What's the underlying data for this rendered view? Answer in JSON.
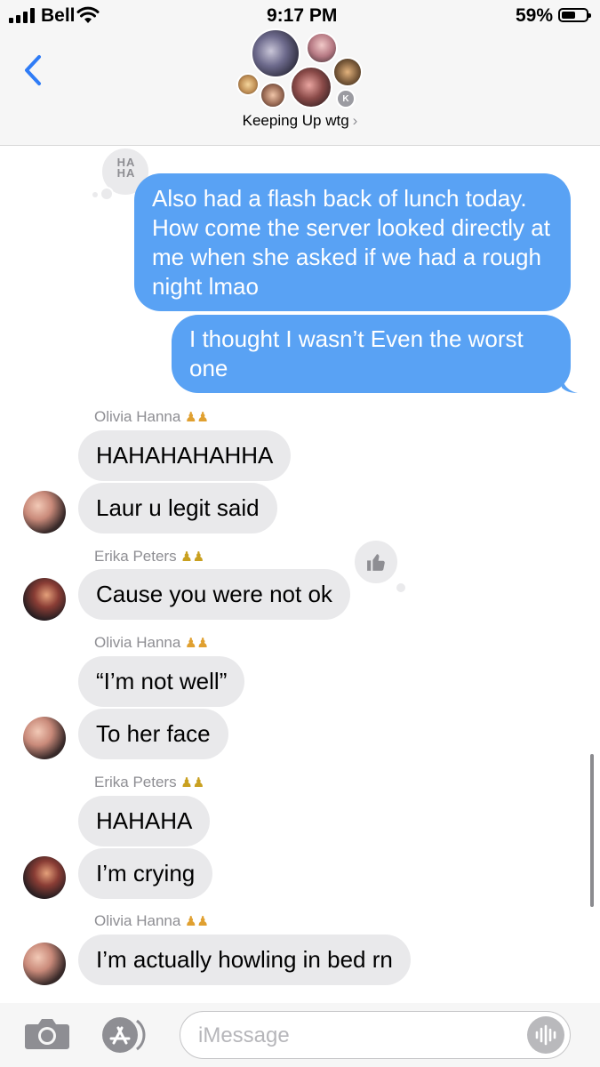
{
  "status_bar": {
    "carrier": "Bell",
    "time": "9:17 PM",
    "battery": "59%"
  },
  "header": {
    "group_name": "Keeping Up wtg",
    "chevron": "›",
    "extra_member_initial": "K"
  },
  "reaction_haha": "HA HA",
  "sent_messages": [
    {
      "text": "Also had a flash back of lunch today. How come the server looked directly at me when she asked if we had a rough night lmao"
    },
    {
      "text": "I thought I wasn’t Even the worst one"
    }
  ],
  "conversation": {
    "names": {
      "olivia_1": "Olivia Hanna",
      "erika_1": "Erika  Peters",
      "olivia_2": "Olivia Hanna",
      "erika_2": "Erika  Peters",
      "olivia_3": "Olivia Hanna"
    },
    "messages": {
      "m1": "HAHAHAHAHHA",
      "m2": "Laur u legit said",
      "m3": "Cause you were not ok",
      "m4": "“I’m not well”",
      "m5": "To her face",
      "m6": "HAHAHA",
      "m7": "I’m crying",
      "m8": "I’m actually howling in bed rn"
    }
  },
  "composer": {
    "placeholder": "iMessage"
  },
  "colors": {
    "sent_bubble": "#59a2f4",
    "received_bubble": "#e9e9eb",
    "accent": "#2f7cf6"
  },
  "icons": [
    "signal-icon",
    "wifi-icon",
    "battery-icon",
    "back-chevron-icon",
    "haha-reaction-icon",
    "thumbs-up-reaction-icon",
    "couple-emoji-icon",
    "camera-icon",
    "app-store-icon",
    "audio-waveform-icon"
  ]
}
